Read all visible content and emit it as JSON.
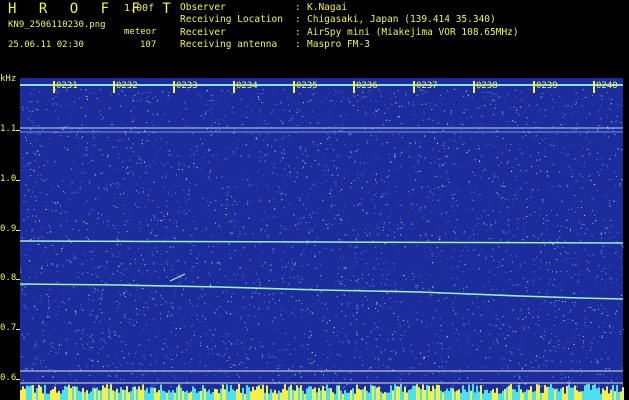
{
  "header": {
    "app_title": "H R O F F T",
    "version": "1.00f",
    "filename": "KN9_2506110230.png",
    "mode_label": "meteor",
    "datetime": "25.06.11 02:30",
    "count": "107"
  },
  "meta": [
    {
      "key": "Observer",
      "value": "K.Nagai"
    },
    {
      "key": "Receiving Location",
      "value": "Chigasaki, Japan (139.414 35.340)"
    },
    {
      "key": "Receiver",
      "value": "AirSpy mini (Miakejima VOR 108.65MHz)"
    },
    {
      "key": "Receiving antenna",
      "value": "Maspro FM-3"
    }
  ],
  "axis": {
    "unit": "kHz",
    "y_ticks": [
      "1.1",
      "1.0",
      "0.9",
      "0.8",
      "0.7",
      "0.6"
    ],
    "time_labels": [
      "0231",
      "0232",
      "0233",
      "0234",
      "0235",
      "0236",
      "0237",
      "0238",
      "0239",
      "0240"
    ]
  },
  "colors": {
    "text": "#eef54a",
    "background": "#1c2c9c",
    "signal": "#9ff0c8"
  }
}
